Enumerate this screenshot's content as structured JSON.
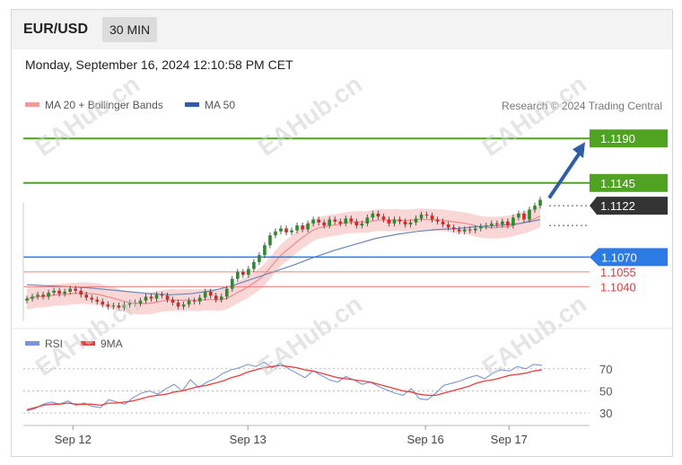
{
  "header": {
    "symbol": "EUR/USD",
    "timeframe": "30 MIN"
  },
  "datetime": "Monday, September 16, 2024 12:10:58 PM CET",
  "credit": "Research © 2024 Trading Central",
  "watermark": "EAHub.cn",
  "colors": {
    "green": "#4fa320",
    "blue": "#2c7be5",
    "red": "#e03a3a",
    "dark": "#333333",
    "candle_up": "#2e8b2e",
    "candle_down": "#d62828",
    "band": "#f7c9c9",
    "ma50": "#6b87b8",
    "rsi": "#7a95d8",
    "rsi9": "#e34040"
  },
  "chart_data": [
    {
      "type": "candlestick",
      "legend": [
        {
          "name": "MA 20 + Bollinger Bands",
          "color": "#f29a9a"
        },
        {
          "name": "MA 50",
          "color": "#2f5da8"
        }
      ],
      "ylim": [
        1.1005,
        1.1212
      ],
      "levels": [
        {
          "value": 1.119,
          "label": "1.1190",
          "kind": "resistance"
        },
        {
          "value": 1.1145,
          "label": "1.1145",
          "kind": "resistance"
        },
        {
          "value": 1.1122,
          "label": "1.1122",
          "kind": "last"
        },
        {
          "value": 1.107,
          "label": "1.1070",
          "kind": "pivot"
        },
        {
          "value": 1.1055,
          "label": "1.1055",
          "kind": "support"
        },
        {
          "value": 1.104,
          "label": "1.1040",
          "kind": "support"
        }
      ],
      "closes": [
        1.1028,
        1.103,
        1.1032,
        1.103,
        1.1034,
        1.1036,
        1.1033,
        1.1035,
        1.1038,
        1.1036,
        1.1032,
        1.1029,
        1.1027,
        1.1025,
        1.1022,
        1.102,
        1.1021,
        1.1019,
        1.1022,
        1.1024,
        1.1023,
        1.1026,
        1.103,
        1.1028,
        1.1032,
        1.1031,
        1.1027,
        1.1024,
        1.102,
        1.1022,
        1.1026,
        1.1025,
        1.1029,
        1.1035,
        1.1031,
        1.1027,
        1.103,
        1.1038,
        1.1048,
        1.1055,
        1.1052,
        1.1058,
        1.1065,
        1.1072,
        1.1082,
        1.1092,
        1.1096,
        1.1099,
        1.1095,
        1.1097,
        1.1102,
        1.1098,
        1.1104,
        1.1108,
        1.1105,
        1.1102,
        1.1108,
        1.1106,
        1.1104,
        1.1109,
        1.1106,
        1.1102,
        1.1104,
        1.111,
        1.1114,
        1.1111,
        1.1108,
        1.1104,
        1.1108,
        1.1106,
        1.1103,
        1.1105,
        1.1109,
        1.1113,
        1.1112,
        1.1108,
        1.1106,
        1.1103,
        1.11,
        1.1098,
        1.1096,
        1.1098,
        1.1097,
        1.1099,
        1.1101,
        1.1102,
        1.1104,
        1.1103,
        1.1106,
        1.1102,
        1.111,
        1.1114,
        1.1108,
        1.1118,
        1.1122,
        1.1128
      ],
      "ma50": [
        1.1042,
        1.1041,
        1.104,
        1.1039,
        1.1037,
        1.1035,
        1.1033,
        1.1032,
        1.1033,
        1.1036,
        1.1041,
        1.1048,
        1.1055,
        1.1062,
        1.107,
        1.1077,
        1.1083,
        1.1089,
        1.1093,
        1.1096,
        1.1098,
        1.1099,
        1.1101,
        1.1102,
        1.1104,
        1.1108
      ],
      "ticks": [
        {
          "pos": 0.095,
          "label": "Sep 12"
        },
        {
          "pos": 0.43,
          "label": "Sep 13"
        },
        {
          "pos": 0.77,
          "label": "Sep 16"
        },
        {
          "pos": 0.93,
          "label": "Sep 17"
        }
      ],
      "projection_target": 1.119
    },
    {
      "type": "line",
      "legend": [
        {
          "name": "RSI",
          "color": "#7a95d8"
        },
        {
          "name": "9MA",
          "color": "#e34040"
        }
      ],
      "ylim": [
        22,
        82
      ],
      "yticks": [
        70,
        50,
        30
      ],
      "yticklabels": [
        "70",
        "50",
        "30"
      ],
      "rsi": [
        32,
        34,
        38,
        40,
        38,
        41,
        37,
        39,
        36,
        35,
        42,
        40,
        38,
        44,
        48,
        50,
        47,
        52,
        56,
        50,
        60,
        53,
        58,
        61,
        66,
        69,
        71,
        74,
        72,
        76,
        71,
        75,
        70,
        66,
        62,
        68,
        64,
        60,
        58,
        63,
        60,
        56,
        58,
        54,
        51,
        48,
        46,
        52,
        43,
        42,
        48,
        55,
        57,
        59,
        62,
        64,
        61,
        66,
        69,
        68,
        72,
        70,
        74,
        73
      ],
      "rsi9": [
        33,
        35,
        37,
        38,
        38,
        39,
        38,
        38,
        38,
        37,
        39,
        39,
        40,
        41,
        43,
        45,
        46,
        47,
        49,
        50,
        52,
        54,
        55,
        57,
        59,
        62,
        64,
        67,
        69,
        71,
        72,
        73,
        72,
        71,
        69,
        68,
        66,
        64,
        62,
        61,
        60,
        59,
        58,
        56,
        54,
        52,
        50,
        49,
        47,
        46,
        46,
        48,
        50,
        52,
        54,
        57,
        59,
        60,
        62,
        64,
        65,
        66,
        68,
        69
      ]
    }
  ]
}
